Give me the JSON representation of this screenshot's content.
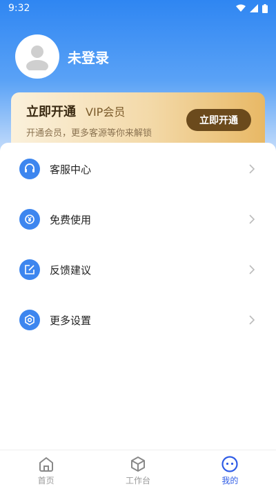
{
  "status_bar": {
    "time": "9:32"
  },
  "profile": {
    "username": "未登录"
  },
  "vip_card": {
    "title": "立即开通",
    "subtitle": "VIP会员",
    "description": "开通会员，更多客源等你来解锁",
    "button_label": "立即开通"
  },
  "menu": {
    "items": [
      {
        "label": "客服中心",
        "icon": "headset-icon"
      },
      {
        "label": "免费使用",
        "icon": "yuan-refresh-icon"
      },
      {
        "label": "反馈建议",
        "icon": "edit-icon"
      },
      {
        "label": "更多设置",
        "icon": "gear-icon"
      }
    ]
  },
  "tabbar": {
    "tabs": [
      {
        "label": "首页",
        "icon": "home-icon"
      },
      {
        "label": "工作台",
        "icon": "cube-icon"
      },
      {
        "label": "我的",
        "icon": "smile-icon",
        "active": true
      }
    ]
  },
  "colors": {
    "primary": "#3d86ef",
    "active_tab": "#2f5ce6",
    "vip_button": "#6b4a1c"
  }
}
